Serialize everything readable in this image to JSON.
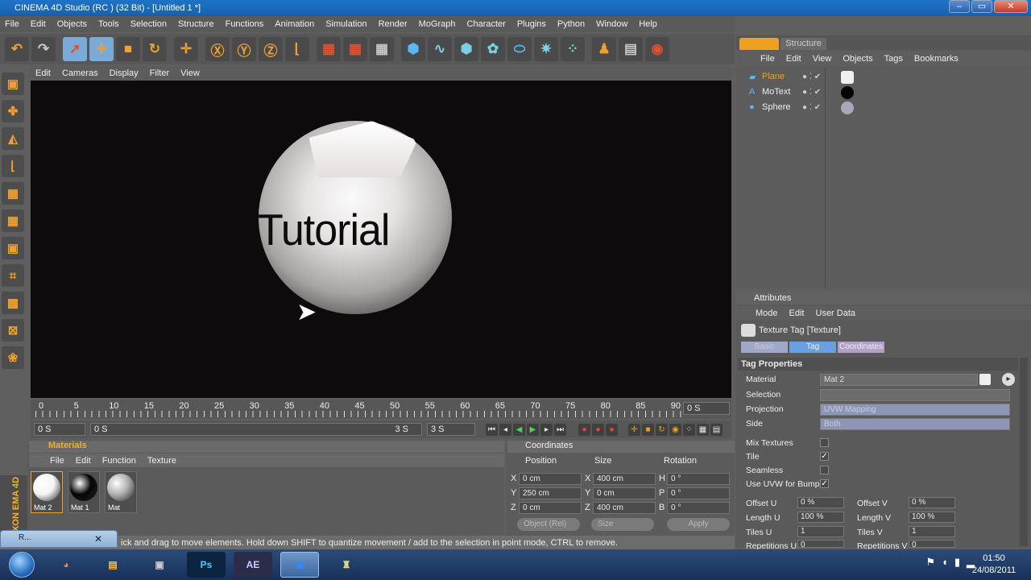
{
  "window": {
    "title": "CINEMA 4D Studio (RC ) (32 Bit) - [Untitled 1 *]",
    "buttons": [
      "–",
      "▭",
      "✕"
    ]
  },
  "menu": [
    "File",
    "Edit",
    "Objects",
    "Tools",
    "Selection",
    "Structure",
    "Functions",
    "Animation",
    "Simulation",
    "Render",
    "MoGraph",
    "Character",
    "Plugins",
    "Python",
    "Window",
    "Help"
  ],
  "viewport": {
    "menu": [
      "Edit",
      "Cameras",
      "Display",
      "Filter",
      "View"
    ],
    "scene_text": "Tutorial"
  },
  "timeline": {
    "ticks": [
      "0",
      "5",
      "10",
      "15",
      "20",
      "25",
      "30",
      "35",
      "40",
      "45",
      "50",
      "55",
      "60",
      "65",
      "70",
      "75",
      "80",
      "85",
      "90"
    ],
    "current": "0 S",
    "start": "0 S",
    "range_start": "0 S",
    "range_end": "3 S",
    "end": "3 S"
  },
  "materials": {
    "title": "Materials",
    "menu": [
      "File",
      "Edit",
      "Function",
      "Texture"
    ],
    "items": [
      {
        "label": "Mat 2",
        "color": "#f4f4f4"
      },
      {
        "label": "Mat 1",
        "color": "#050505"
      },
      {
        "label": "Mat",
        "color": "#b0b0b0"
      }
    ]
  },
  "coordinates": {
    "title": "Coordinates",
    "headers": [
      "Position",
      "Size",
      "Rotation"
    ],
    "rows": [
      {
        "axis": "X",
        "pos": "0 cm",
        "size_axis": "X",
        "size": "400 cm",
        "rot_axis": "H",
        "rot": "0 °"
      },
      {
        "axis": "Y",
        "pos": "250 cm",
        "size_axis": "Y",
        "size": "0 cm",
        "rot_axis": "P",
        "rot": "0 °"
      },
      {
        "axis": "Z",
        "pos": "0 cm",
        "size_axis": "Z",
        "size": "400 cm",
        "rot_axis": "B",
        "rot": "0 °"
      }
    ],
    "mode": "Object (Rel)",
    "size_mode": "Size",
    "apply": "Apply"
  },
  "status": "ick and drag to move elements. Hold down SHIFT to quantize movement / add to the selection in point mode, CTRL to remove.",
  "smallwin": {
    "label": "R..."
  },
  "brand": "XON EMA 4D",
  "objects": {
    "tabs": [
      "Objects",
      "Structure"
    ],
    "menu": [
      "File",
      "Edit",
      "View",
      "Objects",
      "Tags",
      "Bookmarks"
    ],
    "items": [
      {
        "name": "Plane",
        "color": "#f0a020",
        "tag": "#f0f0f0"
      },
      {
        "name": "MoText",
        "color": "#eeeeee",
        "tag": "#050505"
      },
      {
        "name": "Sphere",
        "color": "#eeeeee",
        "tag": "#a8a8b8"
      }
    ]
  },
  "attributes": {
    "title": "Attributes",
    "menu": [
      "Mode",
      "Edit",
      "User Data"
    ],
    "tag_title": "Texture Tag [Texture]",
    "tabs": [
      "Basic",
      "Tag",
      "Coordinates"
    ],
    "section": "Tag Properties",
    "material_label": "Material",
    "material": "Mat 2",
    "selection_label": "Selection",
    "projection_label": "Projection",
    "projection": "UVW Mapping",
    "side_label": "Side",
    "side": "Both",
    "mix_label": "Mix Textures",
    "tile_label": "Tile",
    "seamless_label": "Seamless",
    "uvw_label": "Use UVW for Bump",
    "offset_u_label": "Offset U",
    "offset_u": "0 %",
    "offset_v_label": "Offset V",
    "offset_v": "0 %",
    "length_u_label": "Length U",
    "length_u": "100 %",
    "length_v_label": "Length V",
    "length_v": "100 %",
    "tiles_u_label": "Tiles U",
    "tiles_u": "1",
    "tiles_v_label": "Tiles V",
    "tiles_v": "1",
    "rep_u_label": "Repetitions U",
    "rep_u": "0",
    "rep_v_label": "Repetitions V",
    "rep_v": "0"
  },
  "taskbar": {
    "apps": [
      "chrome",
      "media",
      "Ps",
      "AE",
      "cinema4d",
      "tool"
    ],
    "time": "01:50",
    "date": "24/08/2011"
  }
}
